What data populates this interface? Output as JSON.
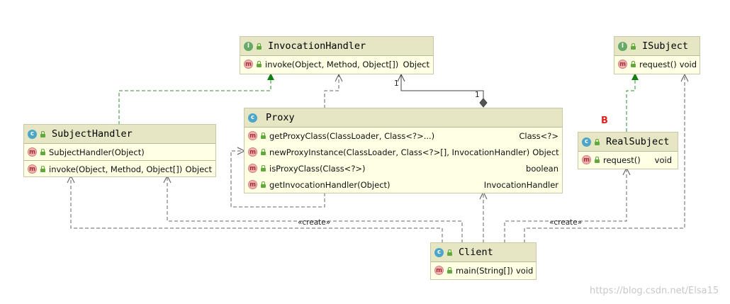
{
  "invocation_handler": {
    "title": "InvocationHandler",
    "kind_badge": "I",
    "methods": [
      {
        "name": "invoke(Object, Method, Object[])",
        "return": "Object"
      }
    ]
  },
  "isubject": {
    "title": "ISubject",
    "kind_badge": "I",
    "methods": [
      {
        "name": "request()",
        "return": "void"
      }
    ]
  },
  "proxy": {
    "title": "Proxy",
    "kind_badge": "c",
    "methods": [
      {
        "name": "getProxyClass(ClassLoader, Class<?>...)",
        "return": "Class<?>"
      },
      {
        "name": "newProxyInstance(ClassLoader, Class<?>[], InvocationHandler)",
        "return": "Object"
      },
      {
        "name": "isProxyClass(Class<?>)",
        "return": "boolean"
      },
      {
        "name": "getInvocationHandler(Object)",
        "return": "InvocationHandler"
      }
    ]
  },
  "subject_handler": {
    "title": "SubjectHandler",
    "kind_badge": "c",
    "constructor": "SubjectHandler(Object)",
    "methods": [
      {
        "name": "invoke(Object, Method, Object[])",
        "return": "Object"
      }
    ]
  },
  "real_subject": {
    "title": "RealSubject",
    "kind_badge": "c",
    "methods": [
      {
        "name": "request()",
        "return": "void"
      }
    ]
  },
  "client": {
    "title": "Client",
    "kind_badge": "c",
    "methods": [
      {
        "name": "main(String[])",
        "return": "void"
      }
    ]
  },
  "method_badge": "m",
  "labels": {
    "multiplicity_one_a": "1",
    "multiplicity_one_b": "1",
    "create_left": "«create»",
    "create_right": "«create»",
    "annotation_b": "B"
  },
  "watermark": "https://blog.csdn.net/Elsa15",
  "colors": {
    "header": "#e6e6c4",
    "body": "#ffffe4",
    "realization_arrow": "#2e8b2e",
    "dependency_line": "#555555",
    "annotation": "#e02020"
  }
}
